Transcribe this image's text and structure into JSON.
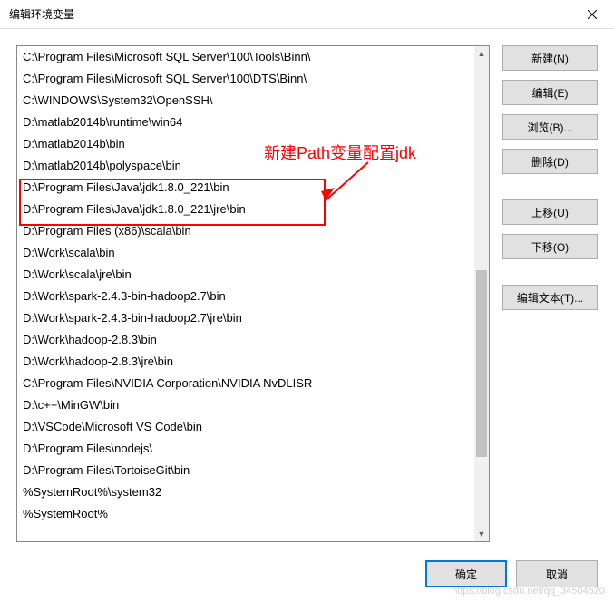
{
  "window": {
    "title": "编辑环境变量"
  },
  "paths": [
    "C:\\Program Files\\Microsoft SQL Server\\100\\Tools\\Binn\\",
    "C:\\Program Files\\Microsoft SQL Server\\100\\DTS\\Binn\\",
    "C:\\WINDOWS\\System32\\OpenSSH\\",
    "D:\\matlab2014b\\runtime\\win64",
    "D:\\matlab2014b\\bin",
    "D:\\matlab2014b\\polyspace\\bin",
    "D:\\Program Files\\Java\\jdk1.8.0_221\\bin",
    "D:\\Program Files\\Java\\jdk1.8.0_221\\jre\\bin",
    "D:\\Program Files (x86)\\scala\\bin",
    "D:\\Work\\scala\\bin",
    "D:\\Work\\scala\\jre\\bin",
    "D:\\Work\\spark-2.4.3-bin-hadoop2.7\\bin",
    "D:\\Work\\spark-2.4.3-bin-hadoop2.7\\jre\\bin",
    "D:\\Work\\hadoop-2.8.3\\bin",
    "D:\\Work\\hadoop-2.8.3\\jre\\bin",
    "C:\\Program Files\\NVIDIA Corporation\\NVIDIA NvDLISR",
    "D:\\c++\\MinGW\\bin",
    "D:\\VSCode\\Microsoft VS Code\\bin",
    "D:\\Program Files\\nodejs\\",
    "D:\\Program Files\\TortoiseGit\\bin",
    "%SystemRoot%\\system32",
    "%SystemRoot%"
  ],
  "buttons": {
    "new": "新建(N)",
    "edit": "编辑(E)",
    "browse": "浏览(B)...",
    "delete": "删除(D)",
    "moveup": "上移(U)",
    "movedown": "下移(O)",
    "edittext": "编辑文本(T)...",
    "ok": "确定",
    "cancel": "取消"
  },
  "annotation": {
    "text": "新建Path变量配置jdk"
  },
  "watermark": "https://blog.csdn.net/qq_34504520"
}
